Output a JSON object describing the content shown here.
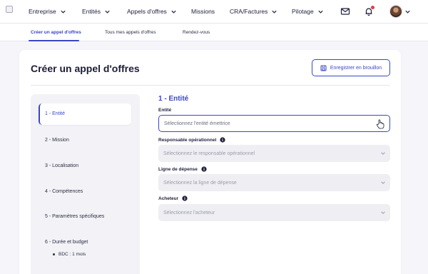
{
  "nav": {
    "items": [
      {
        "label": "Entreprise",
        "dropdown": true
      },
      {
        "label": "Entités",
        "dropdown": true
      },
      {
        "label": "Appels d'offres",
        "dropdown": true
      },
      {
        "label": "Missions",
        "dropdown": false
      },
      {
        "label": "CRA/Factures",
        "dropdown": true
      },
      {
        "label": "Pilotage",
        "dropdown": true
      }
    ],
    "icons": [
      "mail-icon",
      "bell-icon",
      "avatar"
    ]
  },
  "subnav": {
    "items": [
      "Créer un appel d'offres",
      "Tous mes appels d'offres",
      "Rendez-vous"
    ],
    "active": 0
  },
  "page": {
    "title": "Créer un appel d'offres",
    "draft_button": "Enregistrer en brouillon"
  },
  "steps": {
    "items": [
      "1 - Entité",
      "2 - Mission",
      "3 - Localisation",
      "4 - Compétences",
      "5 - Paramètres spécifiques",
      "6 - Durée et budget"
    ],
    "active": 0,
    "substeps": [
      "BDC : 1 mois"
    ]
  },
  "form": {
    "section_title": "1 - Entité",
    "fields": [
      {
        "label": "Entité",
        "placeholder": "Sélectionnez l'entité émettrice",
        "info": false
      },
      {
        "label": "Responsable opérationnel",
        "placeholder": "Sélectionnez le responsable opérationnel",
        "info": true
      },
      {
        "label": "Ligne de dépense",
        "placeholder": "Sélectionnez la ligne de dépense",
        "info": true
      },
      {
        "label": "Acheteur",
        "placeholder": "Sélectionnez l'acheteur",
        "info": true
      }
    ]
  },
  "colors": {
    "accent": "#3b47c4",
    "notification": "#e23a4a"
  }
}
